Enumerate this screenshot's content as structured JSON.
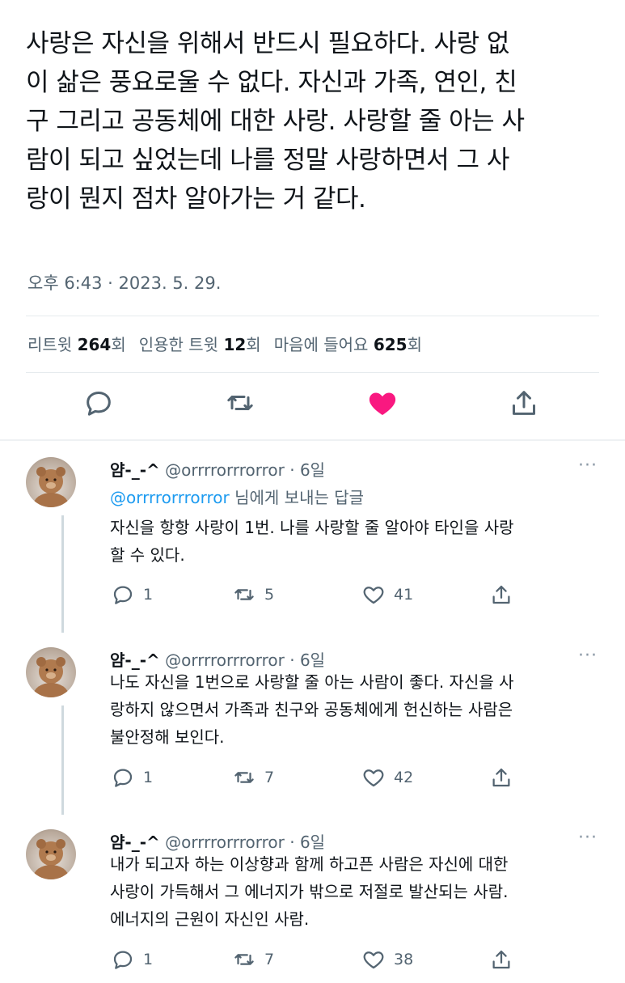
{
  "tweet": {
    "text": "사랑은 자신을 위해서 반드시 필요하다. 사랑 없\n이 삶은 풍요로울 수 없다. 자신과 가족, 연인, 친\n구 그리고 공동체에 대한 사랑. 사랑할 줄 아는 사\n람이 되고 싶었는데 나를 정말 사랑하면서 그 사\n랑이 뭔지 점차 알아가는 거 같다.",
    "timestamp": "오후 6:43 · 2023. 5. 29.",
    "stats": {
      "retweets_label": "리트윗",
      "retweets": "264",
      "retweets_unit": "회",
      "quotes_label": "인용한 트윗",
      "quotes": "12",
      "quotes_unit": "회",
      "likes_label": "마음에 들어요",
      "likes": "625",
      "likes_unit": "회"
    },
    "actions": {
      "reply_icon": "reply-icon",
      "retweet_icon": "retweet-icon",
      "like_icon": "heart-filled-icon",
      "share_icon": "share-icon",
      "like_color": "#f91880"
    }
  },
  "replies": [
    {
      "name": "얌-_-^",
      "handle": "@orrrrorrrorror",
      "sep": " · ",
      "time": "6일",
      "more": "···",
      "replying_to": "@orrrrorrrorror",
      "replying_suffix": " 님에게 보내는 답글",
      "text": "자신을 항항 사랑이 1번. 나를 사랑할 줄 알아야 타인을 사랑\n할 수 있다.",
      "reply_count": "1",
      "retweet_count": "5",
      "like_count": "41"
    },
    {
      "name": "얌-_-^",
      "handle": "@orrrrorrrorror",
      "sep": " · ",
      "time": "6일",
      "more": "···",
      "text": "나도 자신을 1번으로 사랑할 줄 아는 사람이 좋다. 자신을 사\n랑하지 않으면서 가족과 친구와 공동체에게 헌신하는 사람은\n불안정해 보인다.",
      "reply_count": "1",
      "retweet_count": "7",
      "like_count": "42"
    },
    {
      "name": "얌-_-^",
      "handle": "@orrrrorrrorror",
      "sep": " · ",
      "time": "6일",
      "more": "···",
      "text": "내가 되고자 하는 이상향과 함께 하고픈 사람은 자신에 대한\n사랑이 가득해서 그 에너지가 밖으로 저절로 발산되는 사람.\n에너지의 근원이 자신인 사람.",
      "reply_count": "1",
      "retweet_count": "7",
      "like_count": "38"
    }
  ]
}
